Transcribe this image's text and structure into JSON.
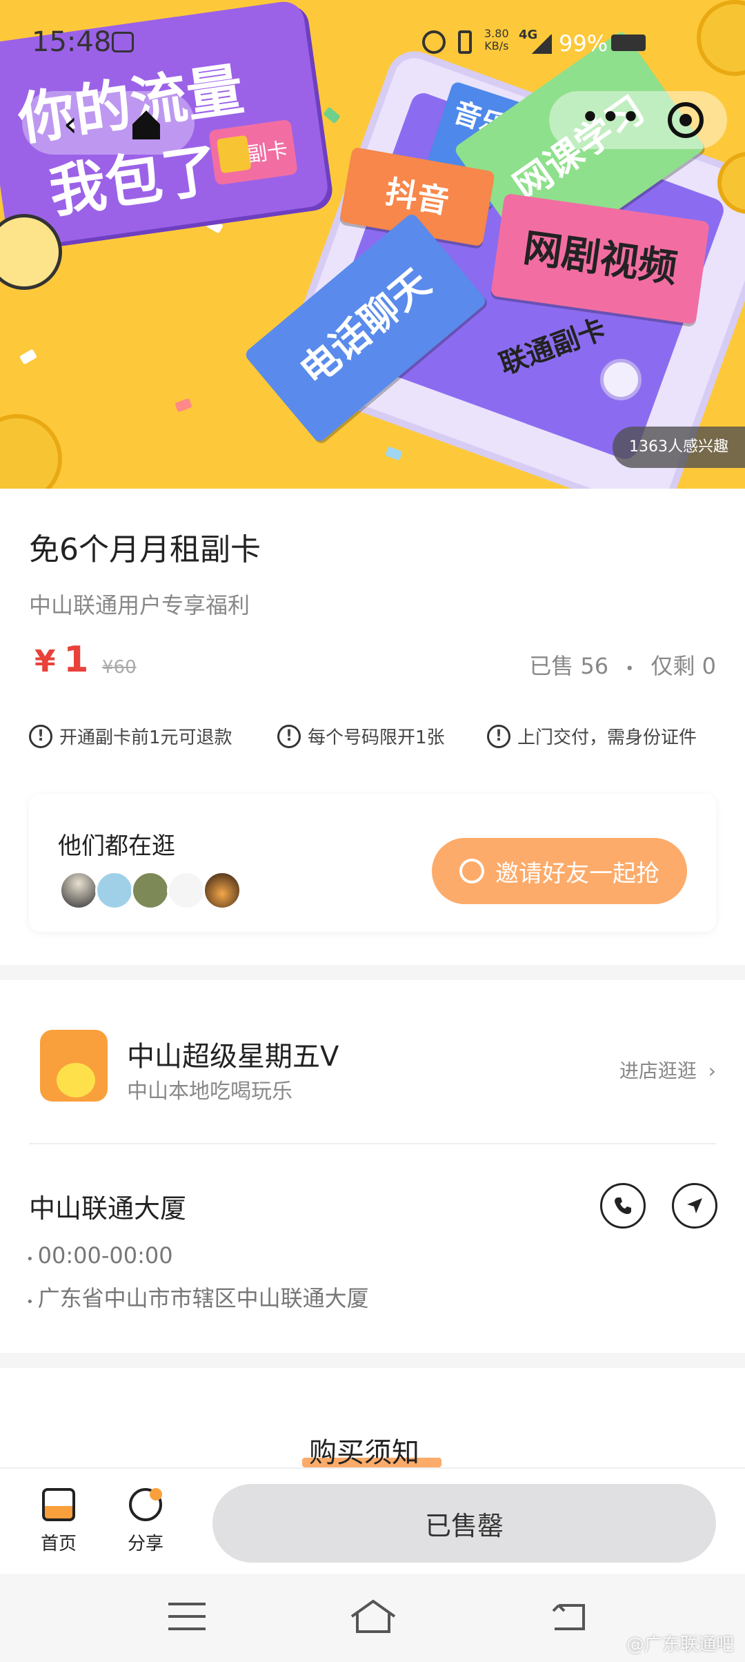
{
  "status": {
    "time": "15:48",
    "net_speed": "3.80",
    "net_unit": "KB/s",
    "signal": "4G",
    "battery": "99%"
  },
  "hero": {
    "headline_1": "你的流量",
    "headline_2": "我包了",
    "sim_label": "副卡",
    "tickets": [
      "音乐",
      "抖音",
      "网课学习",
      "网剧视频",
      "电话聊天"
    ],
    "phone_label": "联通副卡",
    "interest": "1363人感兴趣"
  },
  "product": {
    "title": "免6个月月租副卡",
    "subtitle": "中山联通用户专享福利",
    "price_symbol": "¥",
    "price": "1",
    "original_price": "¥60",
    "sold": "已售 56",
    "dot": "•",
    "remaining": "仅剩 0",
    "notices": [
      "开通副卡前1元可退款",
      "每个号码限开1张",
      "上门交付，需身份证件"
    ]
  },
  "browse": {
    "title": "他们都在逛",
    "invite": "邀请好友一起抢"
  },
  "shop": {
    "name": "中山超级星期五V",
    "desc": "中山本地吃喝玩乐",
    "enter": "进店逛逛"
  },
  "store": {
    "name": "中山联通大厦",
    "hours": "00:00-00:00",
    "address": "广东省中山市市辖区中山联通大厦"
  },
  "purchase_notice": "购买须知",
  "bottom": {
    "home": "首页",
    "share": "分享",
    "sold_out": "已售罄"
  },
  "watermark": "@广东联通吧",
  "colors": {
    "price": "#e8423b",
    "invite": "#fdab6a",
    "hero_bg": "#fdc93a"
  }
}
